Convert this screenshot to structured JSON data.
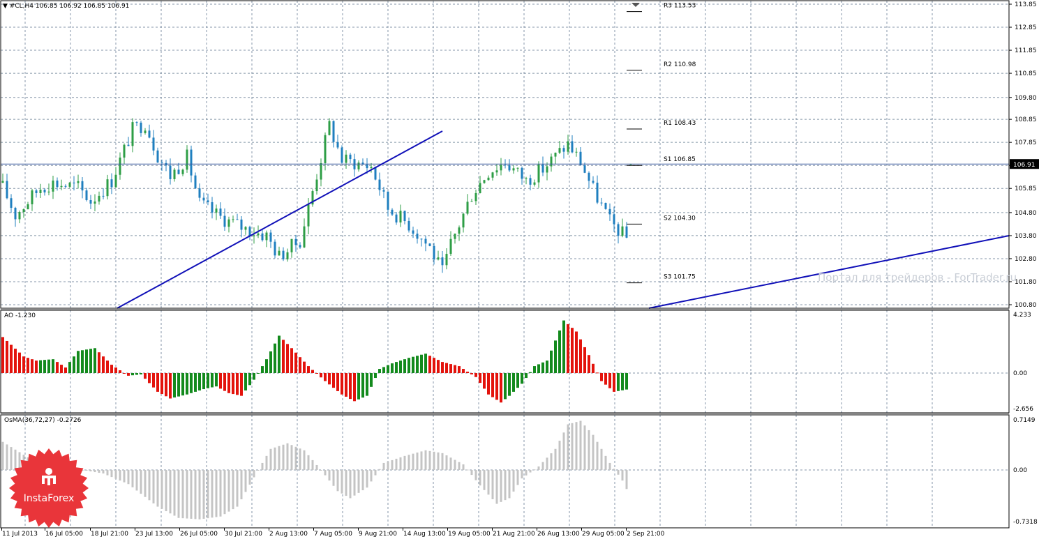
{
  "colors": {
    "candle_up": "#2e9e46",
    "candle_down": "#1f7fbf",
    "ao_up": "#138a1d",
    "ao_down": "#e3130c",
    "osma": "#c4c4c4",
    "trendline": "#1010b8",
    "grid": "#8596a8",
    "bid_line": "#3b5aa0",
    "price_tag_bg": "#000000",
    "logo_red": "#e9353a"
  },
  "header": {
    "symbol_line": "#CL,H4  106.85 106.92 106.85 106.91"
  },
  "price_tag": "106.91",
  "watermark": "Портал для трейдеров - ForTrader.ru",
  "logo": {
    "text": "InstaForex"
  },
  "pivots": [
    {
      "label": "R3 113.53",
      "value": 113.53
    },
    {
      "label": "R2 110.98",
      "value": 110.98
    },
    {
      "label": "R1 108.43",
      "value": 108.43
    },
    {
      "label": "S1 106.85",
      "value": 106.85
    },
    {
      "label": "S2 104.30",
      "value": 104.3
    },
    {
      "label": "S3 101.75",
      "value": 101.75
    }
  ],
  "chart_data": [
    {
      "type": "candlestick",
      "title": "#CL,H4",
      "last_bar": {
        "open": 106.85,
        "high": 106.92,
        "low": 106.85,
        "close": 106.91
      },
      "ylim": [
        100.6,
        113.95
      ],
      "y_ticks": [
        "113.85",
        "112.85",
        "111.85",
        "110.85",
        "109.80",
        "108.85",
        "107.85",
        "106.85",
        "105.85",
        "104.80",
        "103.80",
        "102.80",
        "101.80",
        "100.80"
      ],
      "x_ticks": [
        "11 Jul 2013",
        "16 Jul 05:00",
        "18 Jul 21:00",
        "23 Jul 13:00",
        "26 Jul 05:00",
        "30 Jul 21:00",
        "2 Aug 13:00",
        "7 Aug 05:00",
        "9 Aug 21:00",
        "14 Aug 13:00",
        "19 Aug 05:00",
        "21 Aug 21:00",
        "26 Aug 13:00",
        "29 Aug 05:00",
        "2 Sep 21:00"
      ],
      "close_path": {
        "bar_count": 150,
        "key_closes": [
          [
            0,
            105.9
          ],
          [
            3,
            104.7
          ],
          [
            9,
            105.9
          ],
          [
            12,
            106.1
          ],
          [
            18,
            105.9
          ],
          [
            21,
            105.3
          ],
          [
            26,
            106.2
          ],
          [
            31,
            108.4
          ],
          [
            34,
            108.7
          ],
          [
            37,
            107.3
          ],
          [
            40,
            106.4
          ],
          [
            44,
            107.2
          ],
          [
            47,
            105.2
          ],
          [
            52,
            104.6
          ],
          [
            58,
            104.1
          ],
          [
            63,
            103.8
          ],
          [
            66,
            102.9
          ],
          [
            71,
            103.6
          ],
          [
            78,
            108.6
          ],
          [
            81,
            107.1
          ],
          [
            88,
            106.8
          ],
          [
            92,
            105.0
          ],
          [
            97,
            104.3
          ],
          [
            102,
            103.3
          ],
          [
            105,
            102.2
          ],
          [
            107,
            103.4
          ],
          [
            112,
            105.6
          ],
          [
            116,
            106.6
          ],
          [
            120,
            107.0
          ],
          [
            125,
            106.2
          ],
          [
            129,
            106.7
          ],
          [
            135,
            107.8
          ],
          [
            138,
            107.0
          ],
          [
            141,
            105.8
          ],
          [
            145,
            104.4
          ],
          [
            149,
            103.7
          ]
        ]
      },
      "pivot_levels": {
        "R3": 113.53,
        "R2": 110.98,
        "R1": 108.43,
        "S1": 106.85,
        "S2": 104.3,
        "S3": 101.75
      },
      "trendlines": [
        {
          "from": [
            "11 Jul 2013",
            100.8
          ],
          "to": [
            "14 Aug 13:00",
            108.3
          ]
        }
      ]
    },
    {
      "type": "bar",
      "title": "AO -1.230",
      "ylim": [
        -2.656,
        4.233
      ],
      "y_ticks": [
        "4.233",
        "0.00",
        "-2.656"
      ],
      "histogram": {
        "bar_count": 150,
        "key_values": [
          [
            0,
            2.6
          ],
          [
            5,
            1.2
          ],
          [
            8,
            0.9
          ],
          [
            12,
            1.0
          ],
          [
            15,
            0.4
          ],
          [
            18,
            1.6
          ],
          [
            22,
            1.8
          ],
          [
            26,
            0.6
          ],
          [
            30,
            -0.2
          ],
          [
            33,
            -0.1
          ],
          [
            37,
            -1.4
          ],
          [
            40,
            -1.9
          ],
          [
            44,
            -1.6
          ],
          [
            48,
            -1.2
          ],
          [
            51,
            -1.0
          ],
          [
            54,
            -1.5
          ],
          [
            57,
            -1.7
          ],
          [
            60,
            -0.5
          ],
          [
            63,
            1.0
          ],
          [
            66,
            2.7
          ],
          [
            69,
            1.8
          ],
          [
            73,
            0.5
          ],
          [
            77,
            -0.6
          ],
          [
            81,
            -1.6
          ],
          [
            84,
            -2.1
          ],
          [
            87,
            -1.7
          ],
          [
            90,
            0.3
          ],
          [
            93,
            0.7
          ],
          [
            97,
            1.1
          ],
          [
            101,
            1.4
          ],
          [
            105,
            0.8
          ],
          [
            109,
            0.5
          ],
          [
            113,
            -0.3
          ],
          [
            116,
            -1.6
          ],
          [
            119,
            -2.2
          ],
          [
            121,
            -1.7
          ],
          [
            124,
            -0.8
          ],
          [
            127,
            0.5
          ],
          [
            130,
            0.9
          ],
          [
            134,
            3.8
          ],
          [
            137,
            3.0
          ],
          [
            140,
            1.3
          ],
          [
            143,
            -0.6
          ],
          [
            146,
            -1.4
          ],
          [
            149,
            -1.23
          ]
        ]
      }
    },
    {
      "type": "bar",
      "title": "OsMA(36,72,27) -0.2726",
      "ylim": [
        -0.7318,
        0.7149
      ],
      "y_ticks": [
        "0.7149",
        "0.00",
        "-0.7318"
      ],
      "histogram": {
        "bar_count": 150,
        "key_values": [
          [
            0,
            0.4
          ],
          [
            6,
            0.18
          ],
          [
            13,
            0.08
          ],
          [
            18,
            0.01
          ],
          [
            24,
            -0.05
          ],
          [
            30,
            -0.2
          ],
          [
            37,
            -0.52
          ],
          [
            42,
            -0.68
          ],
          [
            47,
            -0.7
          ],
          [
            52,
            -0.66
          ],
          [
            56,
            -0.52
          ],
          [
            61,
            0.0
          ],
          [
            64,
            0.3
          ],
          [
            68,
            0.38
          ],
          [
            72,
            0.28
          ],
          [
            76,
            0.0
          ],
          [
            80,
            -0.3
          ],
          [
            83,
            -0.4
          ],
          [
            87,
            -0.25
          ],
          [
            91,
            0.1
          ],
          [
            96,
            0.2
          ],
          [
            101,
            0.28
          ],
          [
            105,
            0.24
          ],
          [
            110,
            0.08
          ],
          [
            114,
            -0.22
          ],
          [
            118,
            -0.48
          ],
          [
            121,
            -0.4
          ],
          [
            124,
            -0.12
          ],
          [
            128,
            0.05
          ],
          [
            132,
            0.3
          ],
          [
            135,
            0.65
          ],
          [
            138,
            0.7
          ],
          [
            141,
            0.5
          ],
          [
            145,
            0.1
          ],
          [
            148,
            -0.15
          ],
          [
            149,
            -0.27
          ]
        ]
      }
    }
  ]
}
